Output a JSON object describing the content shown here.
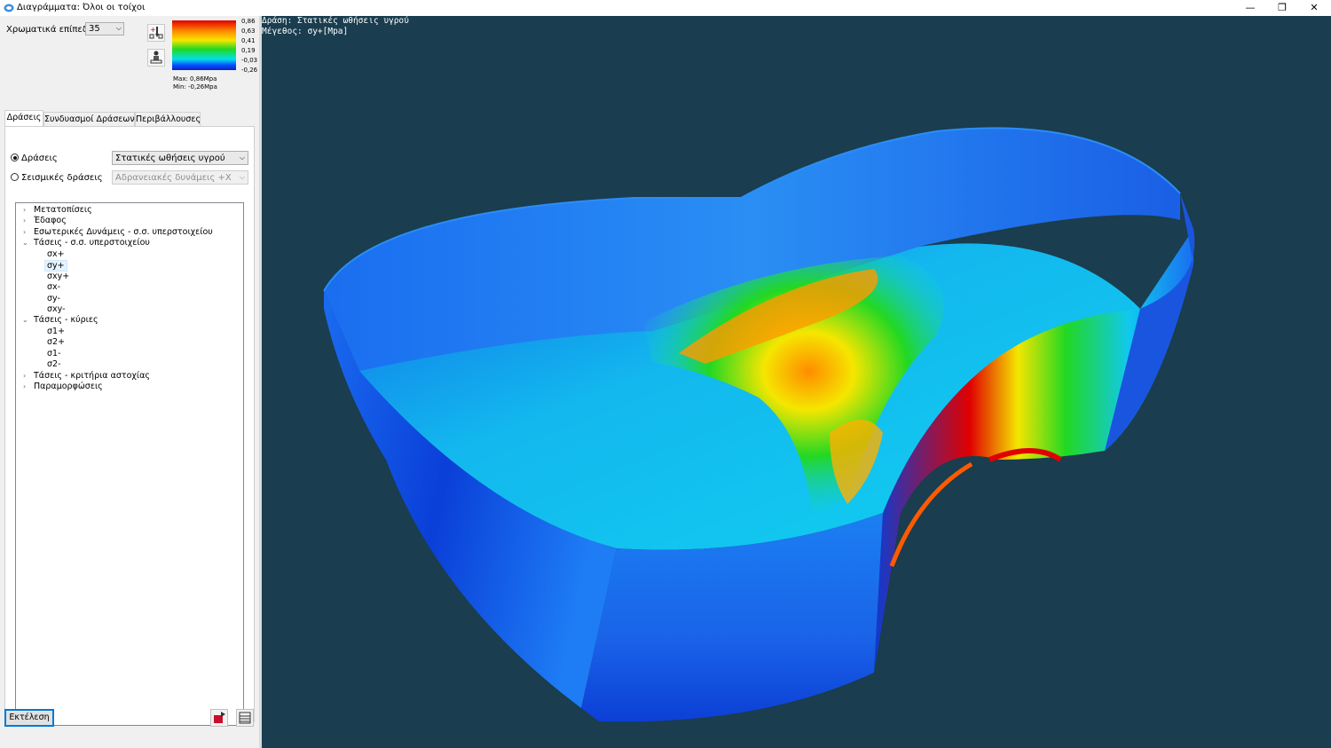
{
  "window": {
    "title": "Διαγράμματα: Όλοι οι τοίχοι",
    "controls": {
      "minimize": "—",
      "maximize": "❐",
      "close": "✕"
    }
  },
  "colorLevels": {
    "label": "Χρωματικά επίπεδα",
    "value": "35"
  },
  "legend": {
    "ticks": [
      "0,86",
      "0,63",
      "0,41",
      "0,19",
      "-0,03",
      "-0,26"
    ],
    "max": "Max: 0,86Mpa",
    "min": "Min: -0,26Mpa"
  },
  "tabs": [
    {
      "label": "Δράσεις",
      "active": true
    },
    {
      "label": "Συνδυασμοί Δράσεων",
      "active": false
    },
    {
      "label": "Περιβάλλουσες",
      "active": false
    }
  ],
  "actions": {
    "option1": {
      "label": "Δράσεις",
      "value": "Στατικές ωθήσεις υγρού",
      "checked": true
    },
    "option2": {
      "label": "Σεισμικές δράσεις",
      "value": "Αδρανειακές δυνάμεις +X",
      "checked": false
    }
  },
  "tree": {
    "n1": "Μετατοπίσεις",
    "n2": "Έδαφος",
    "n3": "Εσωτερικές Δυνάμεις - σ.σ. υπερστοιχείου",
    "n4": "Τάσεις - σ.σ. υπερστοιχείου",
    "c1": "σx+",
    "c2": "σy+",
    "c3": "σxy+",
    "c4": "σx-",
    "c5": "σy-",
    "c6": "σxy-",
    "n5": "Τάσεις - κύριες",
    "c7": "σ1+",
    "c8": "σ2+",
    "c9": "σ1-",
    "c10": "σ2-",
    "n6": "Τάσεις - κριτήρια αστοχίας",
    "n7": "Παραμορφώσεις"
  },
  "buttons": {
    "execute": "Εκτέλεση"
  },
  "viewport": {
    "line1": "Δράση: Στατικές ωθήσεις υγρού",
    "line2": "Μέγεθος: σy+[Mpa]",
    "background": "#1a3d4f"
  },
  "colors": {
    "high": "#e00000",
    "mid_high": "#ff8c00",
    "mid": "#f5e600",
    "mid_low": "#22d822",
    "low": "#00e0e8",
    "lowest": "#1020c0"
  }
}
